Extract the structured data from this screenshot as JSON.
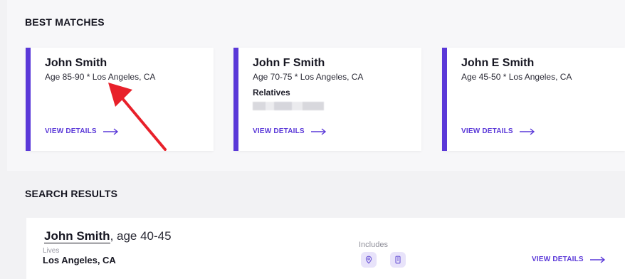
{
  "best_matches": {
    "heading": "BEST MATCHES",
    "cards": [
      {
        "name": "John Smith",
        "meta": "Age 85-90 * Los Angeles, CA",
        "view_label": "VIEW DETAILS"
      },
      {
        "name": "John F Smith",
        "meta": "Age 70-75 * Los Angeles, CA",
        "relatives_label": "Relatives",
        "view_label": "VIEW DETAILS"
      },
      {
        "name": "John E Smith",
        "meta": "Age 45-50 * Los Angeles, CA",
        "view_label": "VIEW DETAILS"
      }
    ]
  },
  "search_results": {
    "heading": "SEARCH RESULTS",
    "result": {
      "name": "John Smith",
      "age": ", age 40-45",
      "lives_label": "Lives",
      "lives_value": "Los Angeles, CA",
      "includes_label": "Includes",
      "includes_icons": [
        "location-pin-icon",
        "phone-icon"
      ],
      "view_label": "VIEW DETAILS"
    }
  },
  "colors": {
    "accent": "#5a38d8",
    "annotation_arrow": "#e8202a"
  }
}
